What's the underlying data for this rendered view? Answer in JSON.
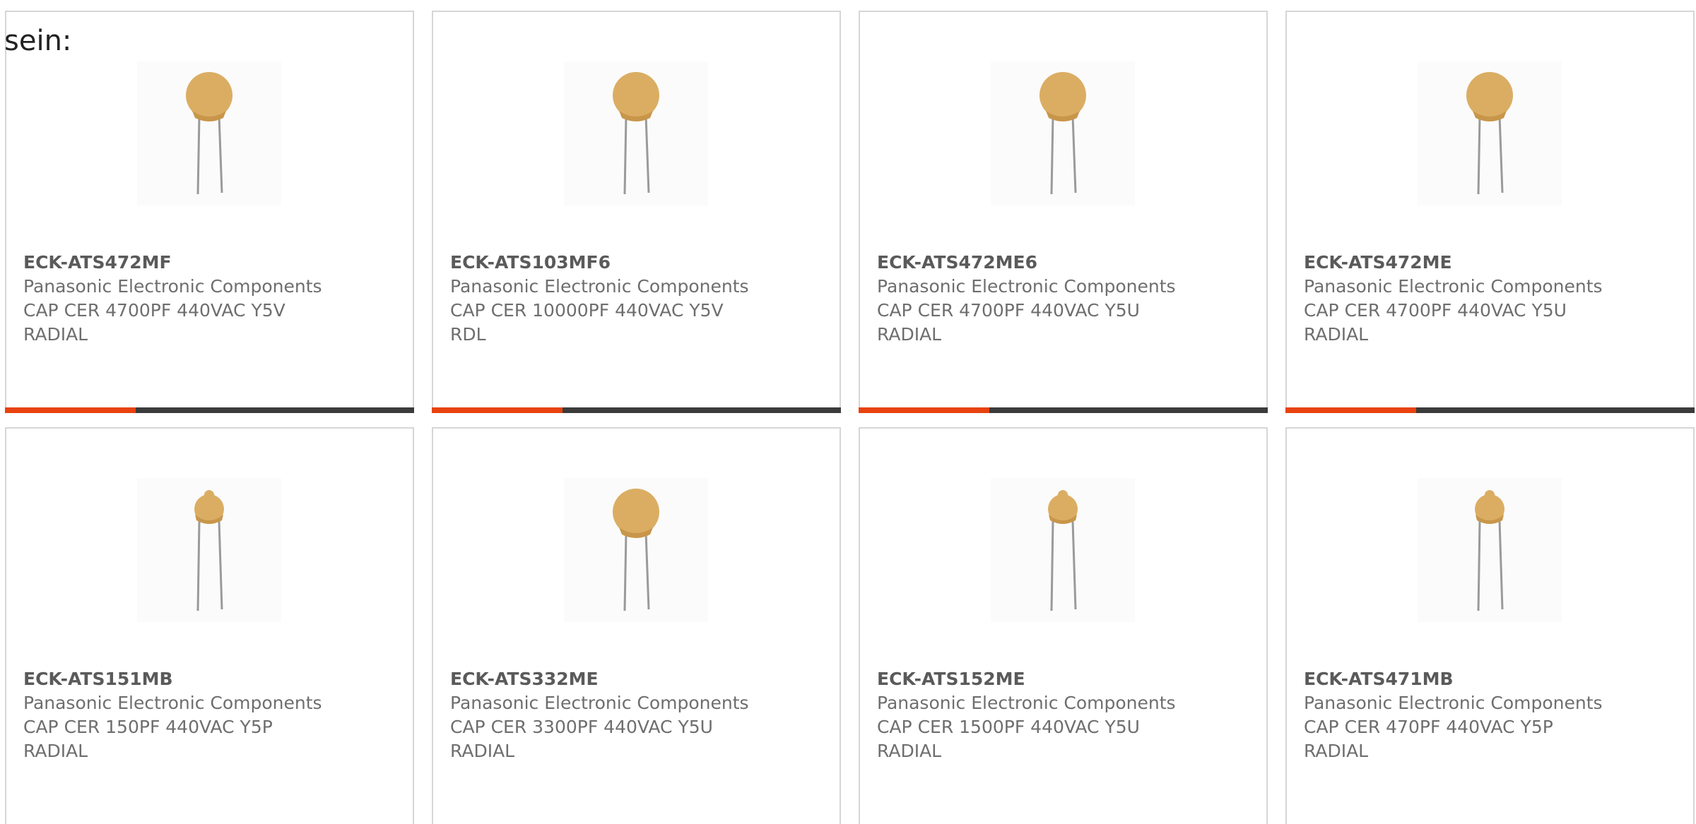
{
  "intro_text": "sein:",
  "colors": {
    "accent": "#e8420e",
    "bar_track": "#3b3b3b",
    "border": "#d6d6d6",
    "part_text": "#5a5a5a",
    "body_text": "#6e6e6e",
    "capacitor_body": "#dbad63"
  },
  "products": [
    {
      "part_number": "ECK-ATS472MF",
      "manufacturer": "Panasonic Electronic Components",
      "description_line1": "CAP CER 4700PF 440VAC Y5V",
      "description_line2": "RADIAL",
      "image_icon": "ceramic-disc-capacitor-icon",
      "disc_size": "large",
      "progress": 0.32
    },
    {
      "part_number": "ECK-ATS103MF6",
      "manufacturer": "Panasonic Electronic Components",
      "description_line1": "CAP CER 10000PF 440VAC Y5V",
      "description_line2": "RDL",
      "image_icon": "ceramic-disc-capacitor-icon",
      "disc_size": "large",
      "progress": 0.32
    },
    {
      "part_number": "ECK-ATS472ME6",
      "manufacturer": "Panasonic Electronic Components",
      "description_line1": "CAP CER 4700PF 440VAC Y5U",
      "description_line2": "RADIAL",
      "image_icon": "ceramic-disc-capacitor-icon",
      "disc_size": "large",
      "progress": 0.32
    },
    {
      "part_number": "ECK-ATS472ME",
      "manufacturer": "Panasonic Electronic Components",
      "description_line1": "CAP CER 4700PF 440VAC Y5U",
      "description_line2": "RADIAL",
      "image_icon": "ceramic-disc-capacitor-icon",
      "disc_size": "large",
      "progress": 0.32
    },
    {
      "part_number": "ECK-ATS151MB",
      "manufacturer": "Panasonic Electronic Components",
      "description_line1": "CAP CER 150PF 440VAC Y5P",
      "description_line2": "RADIAL",
      "image_icon": "ceramic-disc-capacitor-icon",
      "disc_size": "small"
    },
    {
      "part_number": "ECK-ATS332ME",
      "manufacturer": "Panasonic Electronic Components",
      "description_line1": "CAP CER 3300PF 440VAC Y5U",
      "description_line2": "RADIAL",
      "image_icon": "ceramic-disc-capacitor-icon",
      "disc_size": "large"
    },
    {
      "part_number": "ECK-ATS152ME",
      "manufacturer": "Panasonic Electronic Components",
      "description_line1": "CAP CER 1500PF 440VAC Y5U",
      "description_line2": "RADIAL",
      "image_icon": "ceramic-disc-capacitor-icon",
      "disc_size": "small"
    },
    {
      "part_number": "ECK-ATS471MB",
      "manufacturer": "Panasonic Electronic Components",
      "description_line1": "CAP CER 470PF 440VAC Y5P",
      "description_line2": "RADIAL",
      "image_icon": "ceramic-disc-capacitor-icon",
      "disc_size": "small"
    }
  ]
}
